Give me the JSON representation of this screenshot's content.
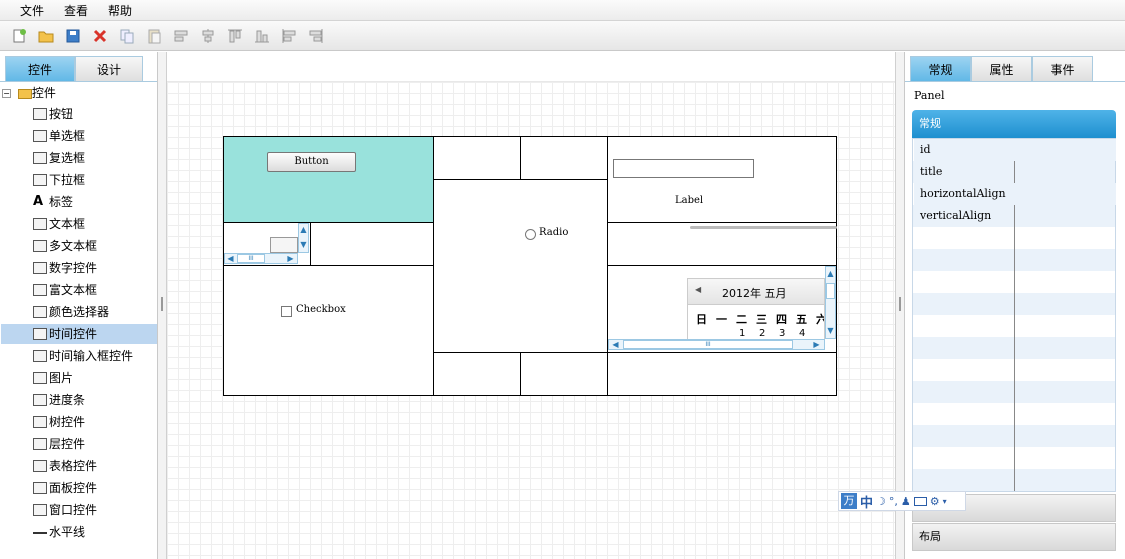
{
  "menu": {
    "file": "文件",
    "view": "查看",
    "help": "帮助"
  },
  "toolbar": {
    "icons": [
      "new-icon",
      "open-icon",
      "save-icon",
      "delete-icon",
      "copy-icon",
      "paste-icon",
      "align-left-icon",
      "align-center-icon",
      "align-top-icon",
      "align-bottom-icon",
      "align-hcenter-icon",
      "align-vcenter-icon"
    ]
  },
  "left_panel": {
    "tabs": [
      "控件",
      "设计"
    ],
    "root": "控件",
    "items": [
      "按钮",
      "单选框",
      "复选框",
      "下拉框",
      "标签",
      "文本框",
      "多文本框",
      "数字控件",
      "富文本框",
      "颜色选择器",
      "时间控件",
      "时间输入框控件",
      "图片",
      "进度条",
      "树控件",
      "层控件",
      "表格控件",
      "面板控件",
      "窗口控件",
      "水平线"
    ],
    "selected_index": 10
  },
  "canvas": {
    "button_label": "Button",
    "radio_label": "Radio",
    "label_text": "Label",
    "checkbox_label": "Checkbox",
    "calendar_title": "2012年 五月",
    "calendar_weekdays": [
      "日",
      "一",
      "二",
      "三",
      "四",
      "五",
      "六"
    ],
    "calendar_dates": [
      "1",
      "2",
      "3",
      "4"
    ],
    "hscroll_mark": "III"
  },
  "right_panel": {
    "tabs": [
      "常规",
      "属性",
      "事件"
    ],
    "object_name": "Panel",
    "section_header": "常规",
    "props": [
      "id",
      "title",
      "horizontalAlign",
      "verticalAlign"
    ],
    "section_bottom": "布局"
  },
  "ime": {
    "label1": "万",
    "label2": "中"
  },
  "colors": {
    "accent": "#5fb7e6",
    "selected": "#bcd6f0",
    "teal_cell": "#99e2dc"
  }
}
